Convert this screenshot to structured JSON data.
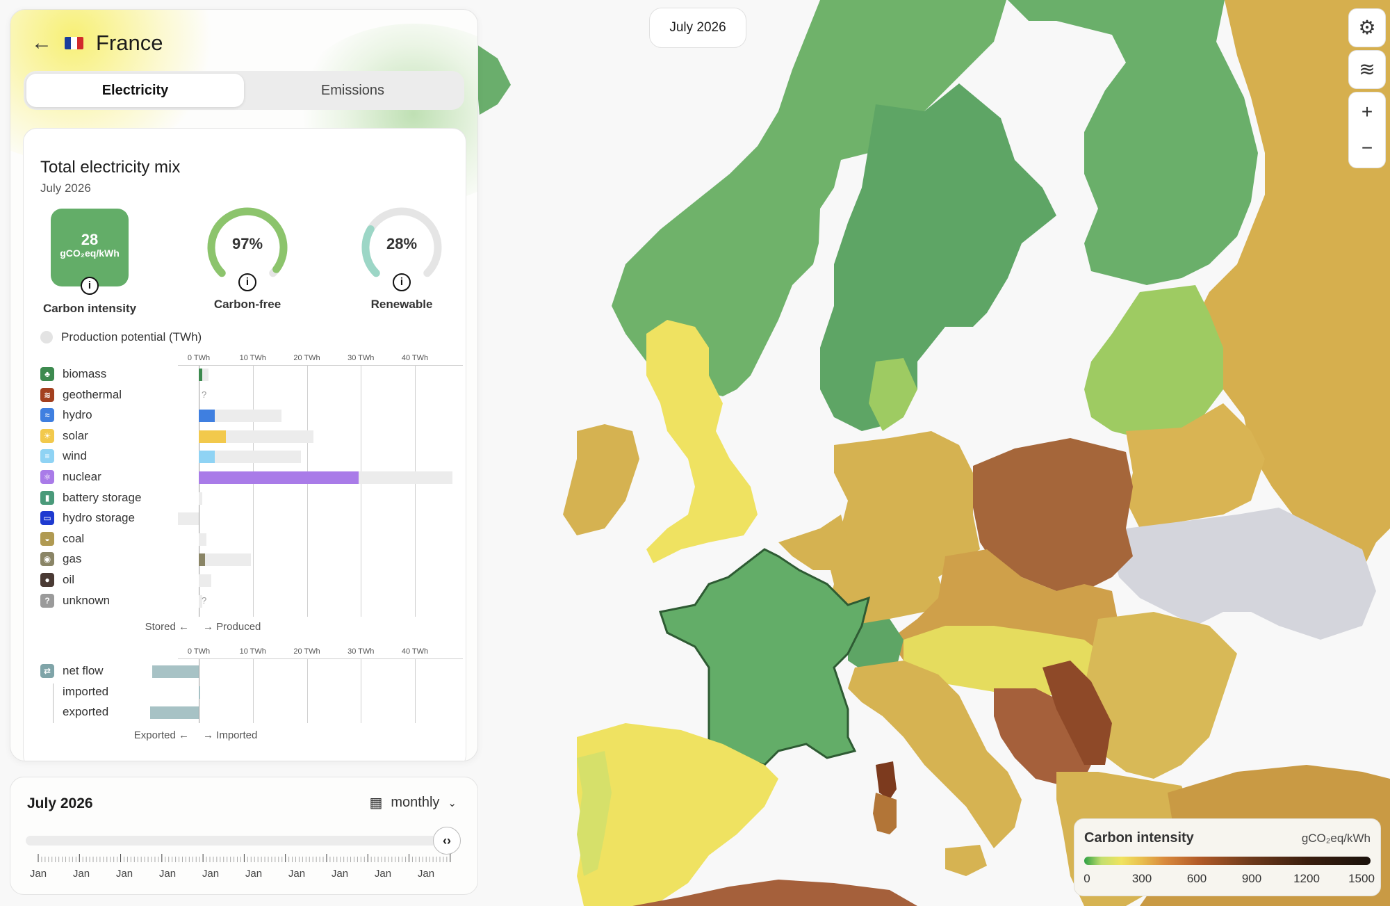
{
  "header": {
    "country": "France"
  },
  "tabs": [
    {
      "label": "Electricity"
    },
    {
      "label": "Emissions"
    }
  ],
  "mix": {
    "title": "Total electricity mix",
    "date": "July 2026",
    "carbon_intensity": {
      "value": "28",
      "unit": "gCO₂eq/kWh",
      "label": "Carbon intensity",
      "color": "#63ad68"
    },
    "carbon_free": {
      "value": "97%",
      "fraction": 0.97,
      "label": "Carbon-free",
      "color": "#8cc46c"
    },
    "renewable": {
      "value": "28%",
      "fraction": 0.28,
      "label": "Renewable",
      "color": "#9cd6c6"
    },
    "production_potential_label": "Production potential (TWh)"
  },
  "chart_data": {
    "type": "bar",
    "ticks": [
      "0 TWh",
      "10 TWh",
      "20 TWh",
      "30 TWh",
      "40 TWh"
    ],
    "xlim": [
      0,
      40
    ],
    "categories": [
      "biomass",
      "geothermal",
      "hydro",
      "solar",
      "wind",
      "nuclear",
      "battery storage",
      "hydro storage",
      "coal",
      "gas",
      "oil",
      "unknown"
    ],
    "production": [
      0.7,
      0,
      2.9,
      5.0,
      3.0,
      29.6,
      0,
      0,
      0,
      1.1,
      0,
      0
    ],
    "potential": [
      1.8,
      0,
      15.3,
      21.2,
      18.9,
      47.0,
      0.6,
      -3.8,
      1.4,
      9.6,
      2.3,
      0.7
    ],
    "unknown_marks": [
      "geothermal",
      "unknown"
    ],
    "colors": [
      "#3d8a4f",
      "#a3401f",
      "#3f7fe0",
      "#f2c94c",
      "#8fd3f4",
      "#a97be8",
      "#4a9a7a",
      "#1e3ad0",
      "#b09a52",
      "#8a8566",
      "#4a3a34",
      "#9a9a9a"
    ],
    "stored_label": "Stored",
    "produced_label": "Produced",
    "flow_categories": [
      "net flow",
      "imported",
      "exported"
    ],
    "flow_values": [
      -8.6,
      0.3,
      -9.0
    ],
    "exported_label": "Exported",
    "imported_label": "Imported"
  },
  "timeline": {
    "date": "July 2026",
    "resolution": "monthly",
    "labels": [
      "Jan",
      "Jan",
      "Jan",
      "Jan",
      "Jan",
      "Jan",
      "Jan",
      "Jan",
      "Jan",
      "Jan"
    ]
  },
  "map": {
    "date_pill": "July 2026"
  },
  "legend": {
    "title": "Carbon intensity",
    "unit": "gCO₂eq/kWh",
    "labels": [
      "0",
      "300",
      "600",
      "900",
      "1200",
      "1500"
    ]
  }
}
